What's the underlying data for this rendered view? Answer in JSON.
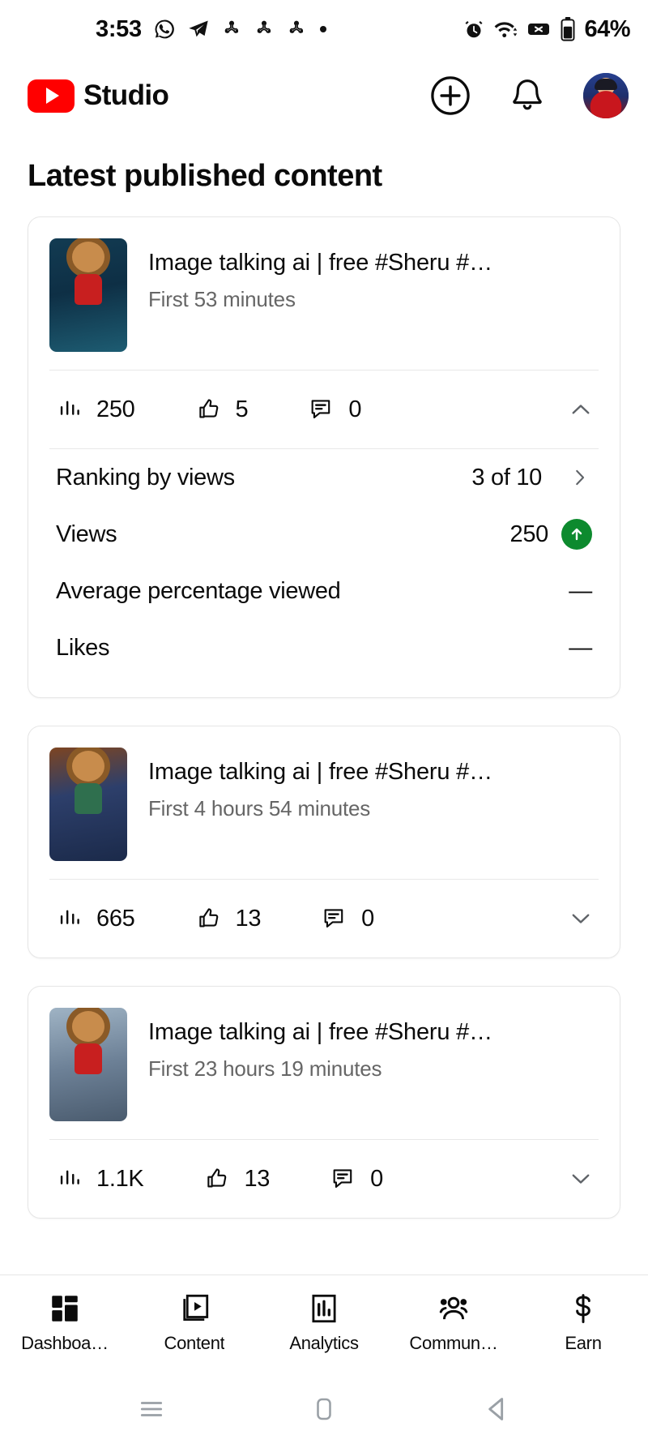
{
  "status_bar": {
    "time": "3:53",
    "battery_text": "64%",
    "left_icons": [
      "whatsapp-icon",
      "telegram-icon",
      "sync-icon",
      "sync-icon",
      "sync-icon",
      "dot-icon"
    ],
    "right_icons": [
      "alarm-icon",
      "wifi-icon",
      "no-sim-icon",
      "battery-icon"
    ]
  },
  "header": {
    "brand": "Studio",
    "logo": "youtube-logo",
    "actions": [
      "create-icon",
      "notifications-icon",
      "avatar"
    ]
  },
  "main": {
    "section_title": "Latest published content",
    "cards": [
      {
        "title": "Image talking ai | free #Sheru #…",
        "subtitle": "First 53 minutes",
        "views": "250",
        "likes": "5",
        "comments": "0",
        "expanded": true,
        "thumb_class": "thumb-a",
        "metrics": [
          {
            "label": "Ranking by views",
            "value": "3 of 10",
            "trailing": "chevron-right"
          },
          {
            "label": "Views",
            "value": "250",
            "trailing": "up-badge"
          },
          {
            "label": "Average percentage viewed",
            "value": "—",
            "trailing": "none"
          },
          {
            "label": "Likes",
            "value": "—",
            "trailing": "none"
          }
        ]
      },
      {
        "title": "Image talking ai | free #Sheru #…",
        "subtitle": "First 4 hours 54 minutes",
        "views": "665",
        "likes": "13",
        "comments": "0",
        "expanded": false,
        "thumb_class": "thumb-b",
        "metrics": []
      },
      {
        "title": "Image talking ai | free #Sheru #…",
        "subtitle": "First 23 hours 19 minutes",
        "views": "1.1K",
        "likes": "13",
        "comments": "0",
        "expanded": false,
        "thumb_class": "thumb-c",
        "metrics": []
      }
    ]
  },
  "bottom_nav": {
    "items": [
      {
        "label": "Dashboa…",
        "icon": "dashboard-icon",
        "active": true
      },
      {
        "label": "Content",
        "icon": "content-icon",
        "active": false
      },
      {
        "label": "Analytics",
        "icon": "analytics-icon",
        "active": false
      },
      {
        "label": "Commun…",
        "icon": "community-icon",
        "active": false
      },
      {
        "label": "Earn",
        "icon": "earn-icon",
        "active": false
      }
    ]
  },
  "system_nav": {
    "buttons": [
      "recents-icon",
      "home-icon",
      "back-icon"
    ]
  },
  "colors": {
    "brand_red": "#FF0000",
    "positive_green": "#0d8a2e",
    "text_primary": "#0b0b0b",
    "text_secondary": "#666666"
  }
}
